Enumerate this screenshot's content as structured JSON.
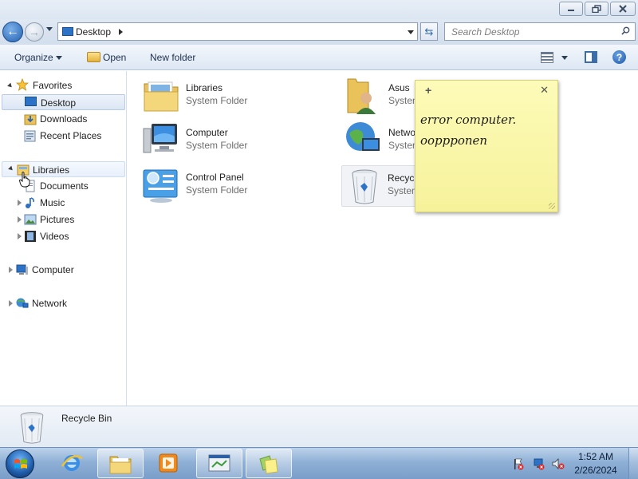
{
  "window": {
    "minimize_icon": "minimize-icon",
    "maximize_icon": "restore-icon",
    "close_icon": "close-icon"
  },
  "address": {
    "crumb": "Desktop",
    "search_placeholder": "Search Desktop"
  },
  "toolbar": {
    "organize": "Organize",
    "open": "Open",
    "new_folder": "New folder"
  },
  "nav": {
    "favorites": "Favorites",
    "desktop": "Desktop",
    "downloads": "Downloads",
    "recent_places": "Recent Places",
    "libraries": "Libraries",
    "documents": "Documents",
    "music": "Music",
    "pictures": "Pictures",
    "videos": "Videos",
    "computer": "Computer",
    "network": "Network"
  },
  "items": [
    {
      "name": "Libraries",
      "type": "System Folder"
    },
    {
      "name": "Computer",
      "type": "System Folder"
    },
    {
      "name": "Control Panel",
      "type": "System Folder"
    },
    {
      "name": "Asus",
      "type": "System"
    },
    {
      "name": "Netwo",
      "type": "System"
    },
    {
      "name": "Recycl",
      "type": "System"
    }
  ],
  "sticky_note": {
    "text": "error computer.\noopp​ponen"
  },
  "details": {
    "name": "Recycle Bin"
  },
  "taskbar": {
    "time": "1:52 AM",
    "date": "2/26/2024"
  },
  "colors": {
    "accent": "#2361b0",
    "sticky": "#fdfbb8",
    "taskbar": "#8fb0d6"
  }
}
